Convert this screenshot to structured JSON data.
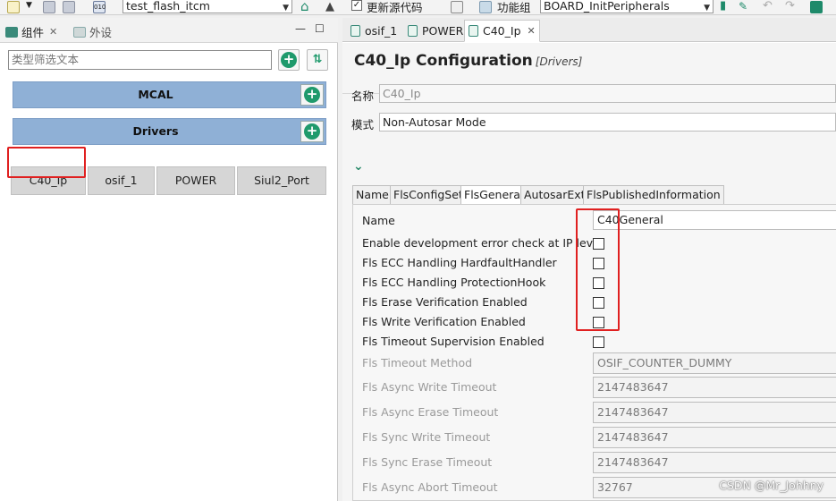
{
  "toolbar": {
    "project": "test_flash_itcm",
    "update_source_label": "更新源代码",
    "function_group_label": "功能组",
    "function_group_value": "BOARD_InitPeripherals"
  },
  "left": {
    "tabs": [
      {
        "label": "组件"
      },
      {
        "label": "外设"
      }
    ],
    "filter_placeholder": "类型筛选文本",
    "categories": [
      {
        "label": "MCAL"
      },
      {
        "label": "Drivers"
      }
    ],
    "components": [
      "C40_Ip",
      "osif_1",
      "POWER",
      "Siul2_Port"
    ]
  },
  "right": {
    "tabs": [
      "osif_1",
      "POWER",
      "C40_Ip"
    ],
    "title": "C40_Ip Configuration",
    "subtitle": "[Drivers]",
    "name_label": "名称",
    "name_value": "C40_Ip",
    "mode_label": "模式",
    "mode_value": "Non-Autosar Mode",
    "inner_tabs": [
      "Name",
      "FlsConfigSet",
      "FlsGeneral",
      "AutosarExt",
      "FlsPublishedInformation"
    ],
    "general": {
      "name_label": "Name",
      "name_value": "C40General",
      "checkboxes": [
        {
          "label": "Enable development error check at IP level",
          "checked": false
        },
        {
          "label": "Fls ECC Handling HardfaultHandler",
          "checked": false
        },
        {
          "label": "Fls ECC Handling ProtectionHook",
          "checked": false
        },
        {
          "label": "Fls Erase Verification Enabled",
          "checked": false
        },
        {
          "label": "Fls Write Verification Enabled",
          "checked": false
        },
        {
          "label": "Fls Timeout Supervision Enabled",
          "checked": false
        }
      ],
      "disabled_fields": [
        {
          "label": "Fls Timeout Method",
          "value": "OSIF_COUNTER_DUMMY"
        },
        {
          "label": "Fls Async Write Timeout",
          "value": "2147483647"
        },
        {
          "label": "Fls Async Erase Timeout",
          "value": "2147483647"
        },
        {
          "label": "Fls Sync Write Timeout",
          "value": "2147483647"
        },
        {
          "label": "Fls Sync Erase Timeout",
          "value": "2147483647"
        },
        {
          "label": "Fls Async Abort Timeout",
          "value": "32767"
        }
      ]
    }
  },
  "watermark": "CSDN @Mr_Johhny",
  "colors": {
    "category_bar": "#8fb0d6",
    "component_button": "#d6d6d6",
    "highlight_outline": "#e02020",
    "add_icon": "#1f9a6c"
  }
}
